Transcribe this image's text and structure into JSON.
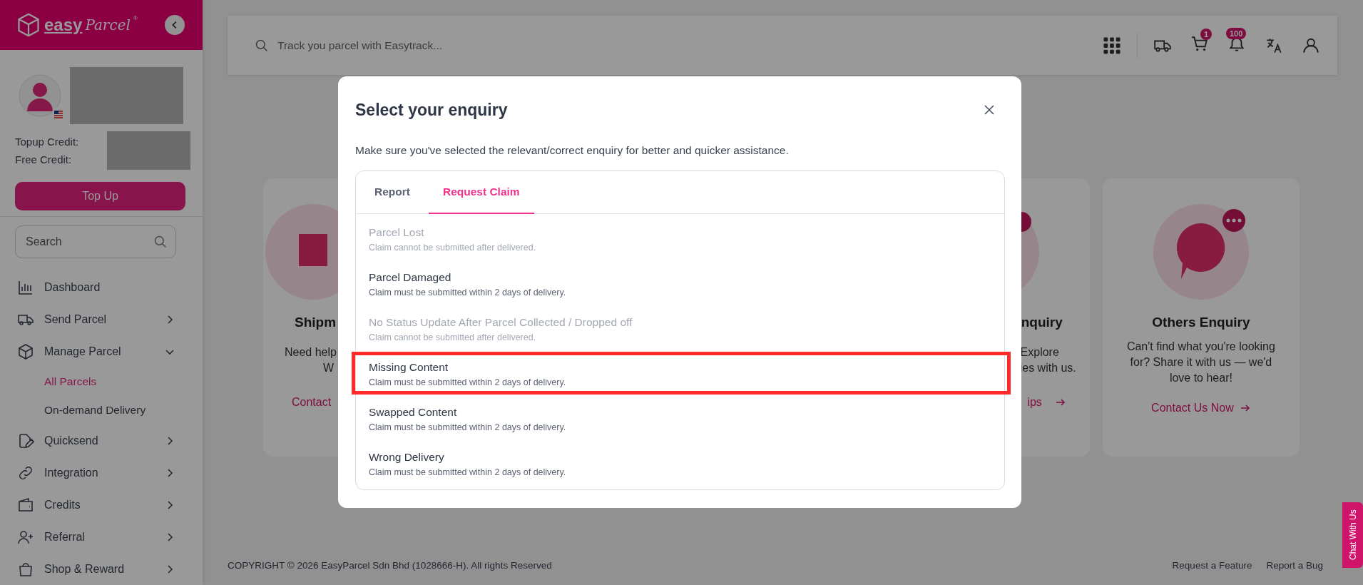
{
  "sidebar": {
    "logo": {
      "text": "easy",
      "script": "Parcel",
      "mark": "®"
    },
    "credits": [
      {
        "label": "Topup Credit:"
      },
      {
        "label": "Free Credit:"
      }
    ],
    "topup_button": "Top Up",
    "search": {
      "placeholder": "Search"
    },
    "nav": [
      {
        "label": "Dashboard",
        "kind": "link"
      },
      {
        "label": "Send Parcel",
        "kind": "group",
        "expanded": false
      },
      {
        "label": "Manage Parcel",
        "kind": "group",
        "expanded": true,
        "children": [
          {
            "label": "All Parcels",
            "selected": true
          },
          {
            "label": "On-demand Delivery",
            "selected": false
          }
        ]
      },
      {
        "label": "Quicksend",
        "kind": "group",
        "expanded": false
      },
      {
        "label": "Integration",
        "kind": "group",
        "expanded": false
      },
      {
        "label": "Credits",
        "kind": "group",
        "expanded": false
      },
      {
        "label": "Referral",
        "kind": "group",
        "expanded": false
      },
      {
        "label": "Shop & Reward",
        "kind": "group",
        "expanded": false
      }
    ]
  },
  "topbar": {
    "search": {
      "placeholder": "Track you parcel with Easytrack..."
    },
    "cart_badge": "1",
    "notification_badge": "100"
  },
  "cards": [
    {
      "kind": "clipped-right",
      "title": "Shipm",
      "lines": [
        "Need help",
        "W"
      ],
      "link": "Contact"
    },
    {
      "kind": "clipped-left",
      "title": "nquiry",
      "lines": [
        "Explore",
        "ies with us."
      ],
      "link": "ips"
    },
    {
      "kind": "full",
      "title": "Others Enquiry",
      "description": "Can't find what you're looking for? Share it with us — we'd love to hear!",
      "link": "Contact Us Now"
    }
  ],
  "footer": {
    "copyright": "COPYRIGHT © 2026 EasyParcel Sdn Bhd (1028666-H). All rights Reserved",
    "links": [
      "Request a Feature",
      "Report a Bug"
    ]
  },
  "chat_tab": "Chat With Us",
  "modal": {
    "title": "Select your enquiry",
    "subtitle": "Make sure you've selected the relevant/correct enquiry for better and quicker assistance.",
    "tabs": [
      {
        "label": "Report",
        "selected": false
      },
      {
        "label": "Request Claim",
        "selected": true
      }
    ],
    "items": [
      {
        "title": "Parcel Lost",
        "note": "Claim cannot be submitted after delivered.",
        "disabled": true,
        "highlighted": false
      },
      {
        "title": "Parcel Damaged",
        "note": "Claim must be submitted within 2 days of delivery.",
        "disabled": false,
        "highlighted": false
      },
      {
        "title": "No Status Update After Parcel Collected / Dropped off",
        "note": "Claim cannot be submitted after delivered.",
        "disabled": true,
        "highlighted": false
      },
      {
        "title": "Missing Content",
        "note": "Claim must be submitted within 2 days of delivery.",
        "disabled": false,
        "highlighted": true
      },
      {
        "title": "Swapped Content",
        "note": "Claim must be submitted within 2 days of delivery.",
        "disabled": false,
        "highlighted": false
      },
      {
        "title": "Wrong Delivery",
        "note": "Claim must be submitted within 2 days of delivery.",
        "disabled": false,
        "highlighted": false
      }
    ]
  }
}
